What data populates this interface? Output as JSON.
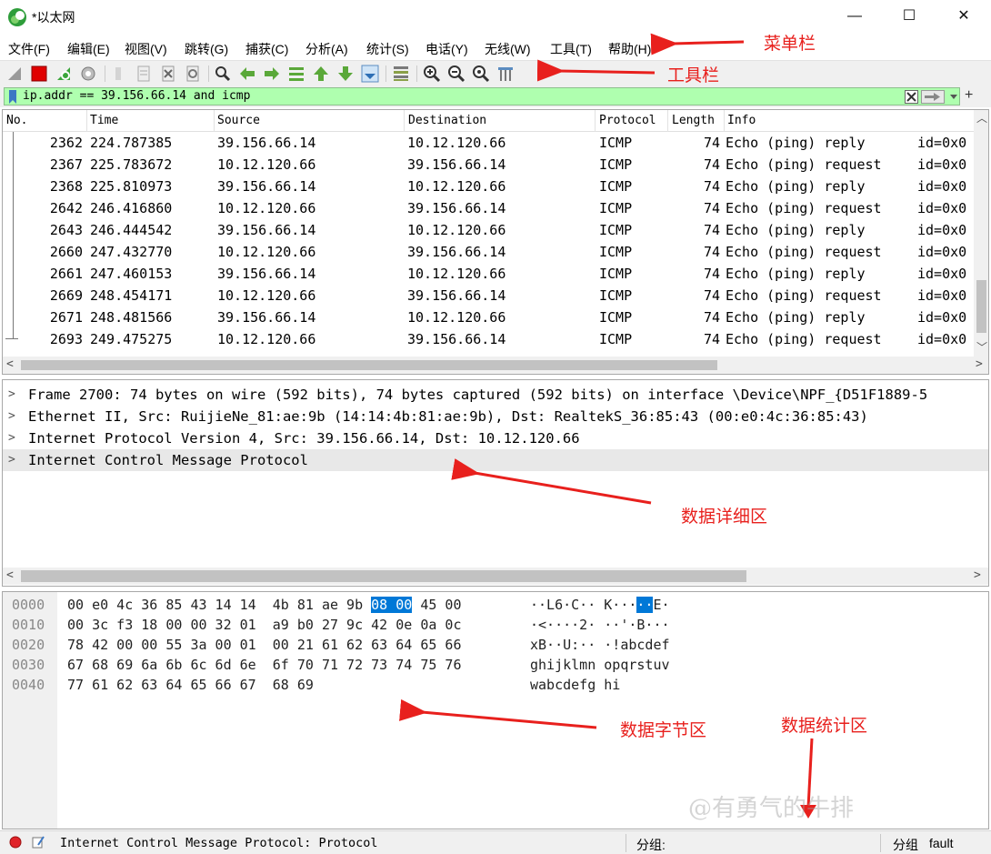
{
  "window": {
    "title": "*以太网",
    "minimize_glyph": "—",
    "maximize_glyph": "☐",
    "close_glyph": "✕"
  },
  "menu": [
    "文件(F)",
    "编辑(E)",
    "视图(V)",
    "跳转(G)",
    "捕获(C)",
    "分析(A)",
    "统计(S)",
    "电话(Y)",
    "无线(W)",
    "工具(T)",
    "帮助(H)"
  ],
  "toolbar_icons": [
    "shark-fin-start-icon",
    "stop-capture-icon",
    "restart-capture-icon",
    "capture-options-icon",
    "open-file-icon",
    "save-file-icon",
    "close-file-icon",
    "reload-file-icon",
    "find-packet-icon",
    "go-back-icon",
    "go-forward-icon",
    "go-to-packet-icon",
    "go-first-icon",
    "go-last-icon",
    "auto-scroll-icon",
    "colorize-icon",
    "zoom-in-icon",
    "zoom-out-icon",
    "normal-size-icon",
    "resize-columns-icon"
  ],
  "filter": {
    "value": "ip.addr == 39.156.66.14 and icmp",
    "bg_color": "#afffaf"
  },
  "packet_list": {
    "columns": [
      "No.",
      "Time",
      "Source",
      "Destination",
      "Protocol",
      "Length",
      "Info"
    ],
    "rows": [
      {
        "no": "2362",
        "time": "224.787385",
        "src": "39.156.66.14",
        "dst": "10.12.120.66",
        "proto": "ICMP",
        "len": "74",
        "info": "Echo (ping) reply",
        "id": "id=0x0"
      },
      {
        "no": "2367",
        "time": "225.783672",
        "src": "10.12.120.66",
        "dst": "39.156.66.14",
        "proto": "ICMP",
        "len": "74",
        "info": "Echo (ping) request",
        "id": "id=0x0"
      },
      {
        "no": "2368",
        "time": "225.810973",
        "src": "39.156.66.14",
        "dst": "10.12.120.66",
        "proto": "ICMP",
        "len": "74",
        "info": "Echo (ping) reply",
        "id": "id=0x0"
      },
      {
        "no": "2642",
        "time": "246.416860",
        "src": "10.12.120.66",
        "dst": "39.156.66.14",
        "proto": "ICMP",
        "len": "74",
        "info": "Echo (ping) request",
        "id": "id=0x0"
      },
      {
        "no": "2643",
        "time": "246.444542",
        "src": "39.156.66.14",
        "dst": "10.12.120.66",
        "proto": "ICMP",
        "len": "74",
        "info": "Echo (ping) reply",
        "id": "id=0x0"
      },
      {
        "no": "2660",
        "time": "247.432770",
        "src": "10.12.120.66",
        "dst": "39.156.66.14",
        "proto": "ICMP",
        "len": "74",
        "info": "Echo (ping) request",
        "id": "id=0x0"
      },
      {
        "no": "2661",
        "time": "247.460153",
        "src": "39.156.66.14",
        "dst": "10.12.120.66",
        "proto": "ICMP",
        "len": "74",
        "info": "Echo (ping) reply",
        "id": "id=0x0"
      },
      {
        "no": "2669",
        "time": "248.454171",
        "src": "10.12.120.66",
        "dst": "39.156.66.14",
        "proto": "ICMP",
        "len": "74",
        "info": "Echo (ping) request",
        "id": "id=0x0"
      },
      {
        "no": "2671",
        "time": "248.481566",
        "src": "39.156.66.14",
        "dst": "10.12.120.66",
        "proto": "ICMP",
        "len": "74",
        "info": "Echo (ping) reply",
        "id": "id=0x0"
      },
      {
        "no": "2693",
        "time": "249.475275",
        "src": "10.12.120.66",
        "dst": "39.156.66.14",
        "proto": "ICMP",
        "len": "74",
        "info": "Echo (ping) request",
        "id": "id=0x0"
      }
    ]
  },
  "details": [
    "Frame 2700: 74 bytes on wire (592 bits), 74 bytes captured (592 bits) on interface \\Device\\NPF_{D51F1889-5",
    "Ethernet II, Src: RuijieNe_81:ae:9b (14:14:4b:81:ae:9b), Dst: RealtekS_36:85:43 (00:e0:4c:36:85:43)",
    "Internet Protocol Version 4, Src: 39.156.66.14, Dst: 10.12.120.66",
    "Internet Control Message Protocol"
  ],
  "bytes": [
    {
      "offset": "0000",
      "hex_a": "00 e0 4c 36 85 43 14 14  4b 81 ae 9b ",
      "hex_sel": "08 00",
      "hex_b": " 45 00",
      "ascii_a": "··L6·C·· K···",
      "ascii_sel": "··",
      "ascii_b": "E·"
    },
    {
      "offset": "0010",
      "hex_a": "00 3c f3 18 00 00 32 01  a9 b0 27 9c 42 0e 0a 0c",
      "hex_sel": "",
      "hex_b": "",
      "ascii_a": "·<····2· ··'·B···",
      "ascii_sel": "",
      "ascii_b": ""
    },
    {
      "offset": "0020",
      "hex_a": "78 42 00 00 55 3a 00 01  00 21 61 62 63 64 65 66",
      "hex_sel": "",
      "hex_b": "",
      "ascii_a": "xB··U:·· ·!abcdef",
      "ascii_sel": "",
      "ascii_b": ""
    },
    {
      "offset": "0030",
      "hex_a": "67 68 69 6a 6b 6c 6d 6e  6f 70 71 72 73 74 75 76",
      "hex_sel": "",
      "hex_b": "",
      "ascii_a": "ghijklmn opqrstuv",
      "ascii_sel": "",
      "ascii_b": ""
    },
    {
      "offset": "0040",
      "hex_a": "77 61 62 63 64 65 66 67  68 69",
      "hex_sel": "",
      "hex_b": "",
      "ascii_a": "wabcdefg hi",
      "ascii_sel": "",
      "ascii_b": ""
    }
  ],
  "status": {
    "text": "Internet Control Message Protocol: Protocol",
    "packets_label": "分组:",
    "profile_label": "分组",
    "profile_value": "fault"
  },
  "annotations": {
    "menubar": "菜单栏",
    "toolbar": "工具栏",
    "details": "数据详细区",
    "bytes": "数据字节区",
    "stats": "数据统计区",
    "color": "#e8201d"
  },
  "watermark": "@有勇气的牛排"
}
